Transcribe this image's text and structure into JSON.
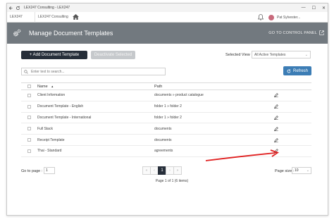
{
  "window": {
    "app_title": "LEX247 Consulting - LEX247",
    "back_icon": "arrow-left-icon",
    "refresh_icon": "reload-icon",
    "controls": {
      "minimize": "—",
      "maximize": "☐",
      "close": "✕"
    }
  },
  "context_bar": {
    "tabs": [
      {
        "label": "LEX247"
      },
      {
        "label": "LEX247 Consulting"
      }
    ],
    "user_name": "Pat Sylvester..."
  },
  "header": {
    "title": "Manage Document Templates",
    "control_panel_label": "GO TO CONTROL PANEL"
  },
  "toolbar": {
    "add_label": "+ Add Document Template",
    "deactivate_label": "Deactivate Selected",
    "selected_view_label": "Selected View",
    "selected_view_value": "All Active Templates",
    "search_placeholder": "Enter text to search...",
    "refresh_label": "Refresh"
  },
  "table": {
    "columns": {
      "name": "Name",
      "path": "Path"
    },
    "rows": [
      {
        "name": "Client Information",
        "path": "documents » product catalogue"
      },
      {
        "name": "Document Template - English",
        "path": "folder 1 » folder 2"
      },
      {
        "name": "Document Template - International",
        "path": "folder 1 » folder 2"
      },
      {
        "name": "Full Stack",
        "path": "documents"
      },
      {
        "name": "Receipt Template",
        "path": "documents"
      },
      {
        "name": "Thai - Standard",
        "path": "agreements"
      }
    ]
  },
  "footer": {
    "goto_label": "Go to page :",
    "goto_value": "1",
    "pager": {
      "first": "«",
      "prev": "‹",
      "current": "1",
      "next": "›",
      "last": "»"
    },
    "page_info": "Page 1 of 1 (6 items)",
    "page_size_label": "Page size :",
    "page_size_value": "10"
  },
  "colors": {
    "header_bg": "#72797f",
    "primary_btn": "#272f3a",
    "refresh_btn": "#3c7db5",
    "annotation_arrow": "#e02020"
  }
}
